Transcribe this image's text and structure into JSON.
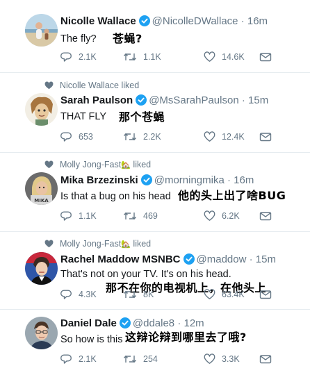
{
  "tweets": [
    {
      "name": "Nicolle Wallace",
      "handle": "@NicolleDWallace",
      "time": "16m",
      "text": "The fly?",
      "annotation": "苍蝇?",
      "replies": "2.1K",
      "retweets": "1.1K",
      "likes": "14.6K"
    },
    {
      "liked_by": "Nicolle Wallace liked",
      "name": "Sarah Paulson",
      "handle": "@MsSarahPaulson",
      "time": "15m",
      "text": "THAT FLY",
      "annotation": "那个苍蝇",
      "replies": "653",
      "retweets": "2.2K",
      "likes": "12.4K"
    },
    {
      "liked_by": "Molly Jong-Fast",
      "liked_suffix": "liked",
      "name": "Mika Brzezinski",
      "handle": "@morningmika",
      "time": "16m",
      "text": "Is that a bug on his head",
      "annotation": "他的头上出了啥BUG",
      "replies": "1.1K",
      "retweets": "469",
      "likes": "6.2K"
    },
    {
      "liked_by": "Molly Jong-Fast",
      "liked_suffix": "liked",
      "name": "Rachel Maddow MSNBC",
      "handle": "@maddow",
      "time": "15m",
      "text": "That's not on your TV. It's on his head.",
      "annotation": "那不在你的电视机上，在他头上",
      "replies": "4.3K",
      "retweets": "8K",
      "likes": "63.4K"
    },
    {
      "name": "Daniel Dale",
      "handle": "@ddale8",
      "time": "12m",
      "text": "So how is this",
      "annotation": "这辩论辩到哪里去了哦?",
      "replies": "2.1K",
      "retweets": "254",
      "likes": "3.3K"
    }
  ],
  "colors": {
    "verified": "#1da1f2",
    "muted": "#657786",
    "divider": "#e6ecf0"
  },
  "icons": [
    "reply-icon",
    "retweet-icon",
    "like-icon",
    "direct-message-icon",
    "verified-badge-icon",
    "heart-icon",
    "house-emoji"
  ]
}
